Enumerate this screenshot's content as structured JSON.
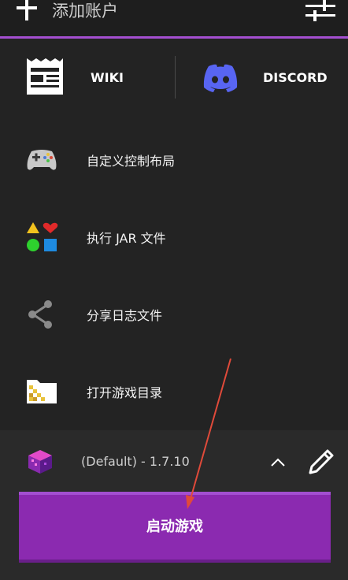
{
  "topbar": {
    "add_account_label": "添加账户",
    "icons": {
      "add": "plus-icon",
      "settings": "sliders-icon"
    },
    "accent_color": "#a44fd0"
  },
  "links": {
    "wiki_label": "WIKI",
    "discord_label": "DISCORD",
    "discord_color": "#5865f2"
  },
  "menu": {
    "items": [
      {
        "label": "自定义控制布局",
        "icon": "gamepad-icon"
      },
      {
        "label": "执行 JAR 文件",
        "icon": "shapes-icon"
      },
      {
        "label": "分享日志文件",
        "icon": "share-icon"
      },
      {
        "label": "打开游戏目录",
        "icon": "folder-icon"
      }
    ]
  },
  "profile": {
    "label": "(Default) - 1.7.10",
    "icon": "minecraft-block-icon"
  },
  "launch_button": {
    "label": "启动游戏",
    "color": "#8b2ab0"
  },
  "annotation": {
    "arrow_color": "#e04a3a"
  }
}
